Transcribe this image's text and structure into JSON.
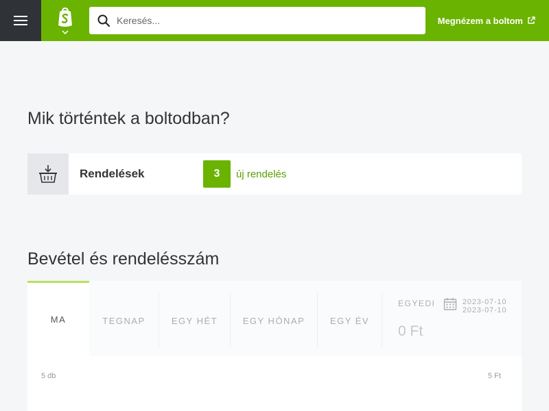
{
  "topbar": {
    "menu_icon": "hamburger-menu-icon",
    "logo_icon": "shop-logo-icon",
    "search": {
      "placeholder": "Keresés...",
      "value": ""
    },
    "shop_link": {
      "label": "Megnézem a boltom",
      "icon": "external-link-icon"
    },
    "brand_color": "#6ab300"
  },
  "events": {
    "title": "Mik történtek a boltodban?",
    "orders": {
      "icon": "basket-icon",
      "label": "Rendelések",
      "new_count": "3",
      "new_label": "új rendelés"
    }
  },
  "revenue": {
    "title": "Bevétel és rendelésszám",
    "tabs": [
      {
        "label": "MA",
        "active": true
      },
      {
        "label": "TEGNAP"
      },
      {
        "label": "EGY HÉT"
      },
      {
        "label": "EGY HÓNAP"
      },
      {
        "label": "EGY ÉV"
      }
    ],
    "custom": {
      "label": "EGYEDI",
      "icon": "calendar-icon",
      "date_from": "2023-07-10",
      "date_to": "2023-07-10",
      "amount": "0 Ft"
    },
    "axis_left": "5 db",
    "axis_right": "5 Ft"
  }
}
